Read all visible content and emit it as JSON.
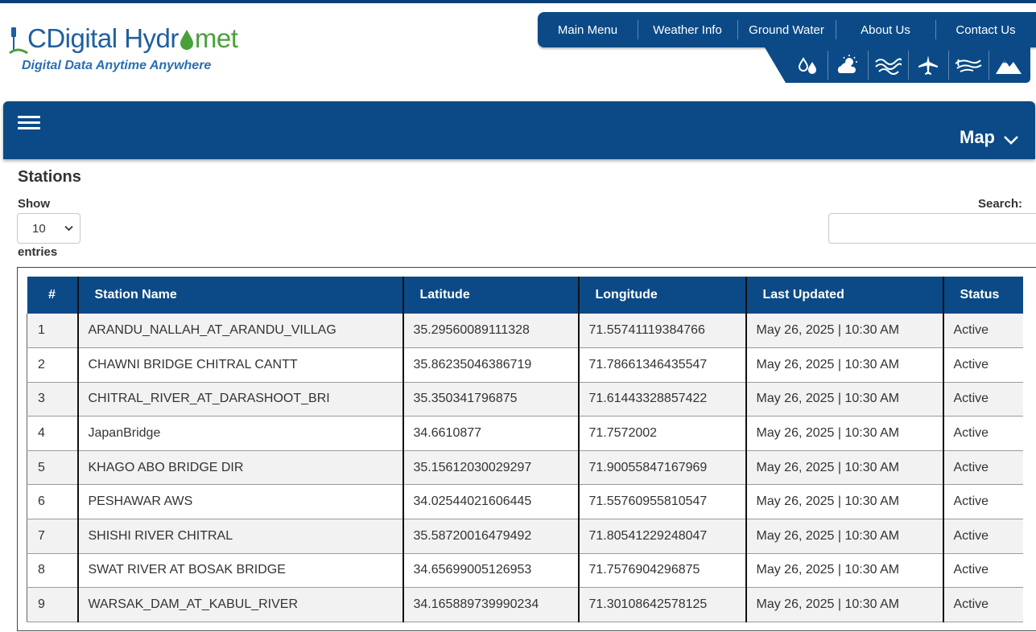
{
  "brand": {
    "logo_part1": "CDigital Hydr",
    "logo_part2": "met",
    "tagline": "Digital Data Anytime Anywhere"
  },
  "topnav": {
    "items": [
      {
        "label": "Main Menu"
      },
      {
        "label": "Weather Info"
      },
      {
        "label": "Ground Water"
      },
      {
        "label": "About Us"
      },
      {
        "label": "Contact Us"
      }
    ]
  },
  "iconbar": {
    "icons": [
      "water-drops-icon",
      "cloud-sun-icon",
      "waves-icon",
      "airplane-icon",
      "wind-icon",
      "mountains-icon"
    ]
  },
  "header": {
    "map_label": "Map"
  },
  "section": {
    "title": "Stations",
    "show_label": "Show",
    "entries_value": "10",
    "entries_label": "entries",
    "search_label": "Search:",
    "search_value": ""
  },
  "table": {
    "columns": [
      "#",
      "Station Name",
      "Latitude",
      "Longitude",
      "Last Updated",
      "Status"
    ],
    "rows": [
      [
        "1",
        "ARANDU_NALLAH_AT_ARANDU_VILLAG",
        "35.29560089111328",
        "71.55741119384766",
        "May 26, 2025 | 10:30 AM",
        "Active"
      ],
      [
        "2",
        "CHAWNI BRIDGE CHITRAL CANTT",
        "35.86235046386719",
        "71.78661346435547",
        "May 26, 2025 | 10:30 AM",
        "Active"
      ],
      [
        "3",
        "CHITRAL_RIVER_AT_DARASHOOT_BRI",
        "35.350341796875",
        "71.61443328857422",
        "May 26, 2025 | 10:30 AM",
        "Active"
      ],
      [
        "4",
        "JapanBridge",
        "34.6610877",
        "71.7572002",
        "May 26, 2025 | 10:30 AM",
        "Active"
      ],
      [
        "5",
        "KHAGO ABO BRIDGE DIR",
        "35.15612030029297",
        "71.90055847167969",
        "May 26, 2025 | 10:30 AM",
        "Active"
      ],
      [
        "6",
        "PESHAWAR AWS",
        "34.02544021606445",
        "71.55760955810547",
        "May 26, 2025 | 10:30 AM",
        "Active"
      ],
      [
        "7",
        "SHISHI RIVER CHITRAL",
        "35.58720016479492",
        "71.80541229248047",
        "May 26, 2025 | 10:30 AM",
        "Active"
      ],
      [
        "8",
        "SWAT RIVER AT BOSAK BRIDGE",
        "34.65699005126953",
        "71.7576904296875",
        "May 26, 2025 | 10:30 AM",
        "Active"
      ],
      [
        "9",
        "WARSAK_DAM_AT_KABUL_RIVER",
        "34.165889739990234",
        "71.30108642578125",
        "May 26, 2025 | 10:30 AM",
        "Active"
      ]
    ]
  },
  "colors": {
    "primary_blue": "#0b4a86",
    "logo_blue": "#1f5fa0",
    "logo_green": "#4aa03a"
  }
}
